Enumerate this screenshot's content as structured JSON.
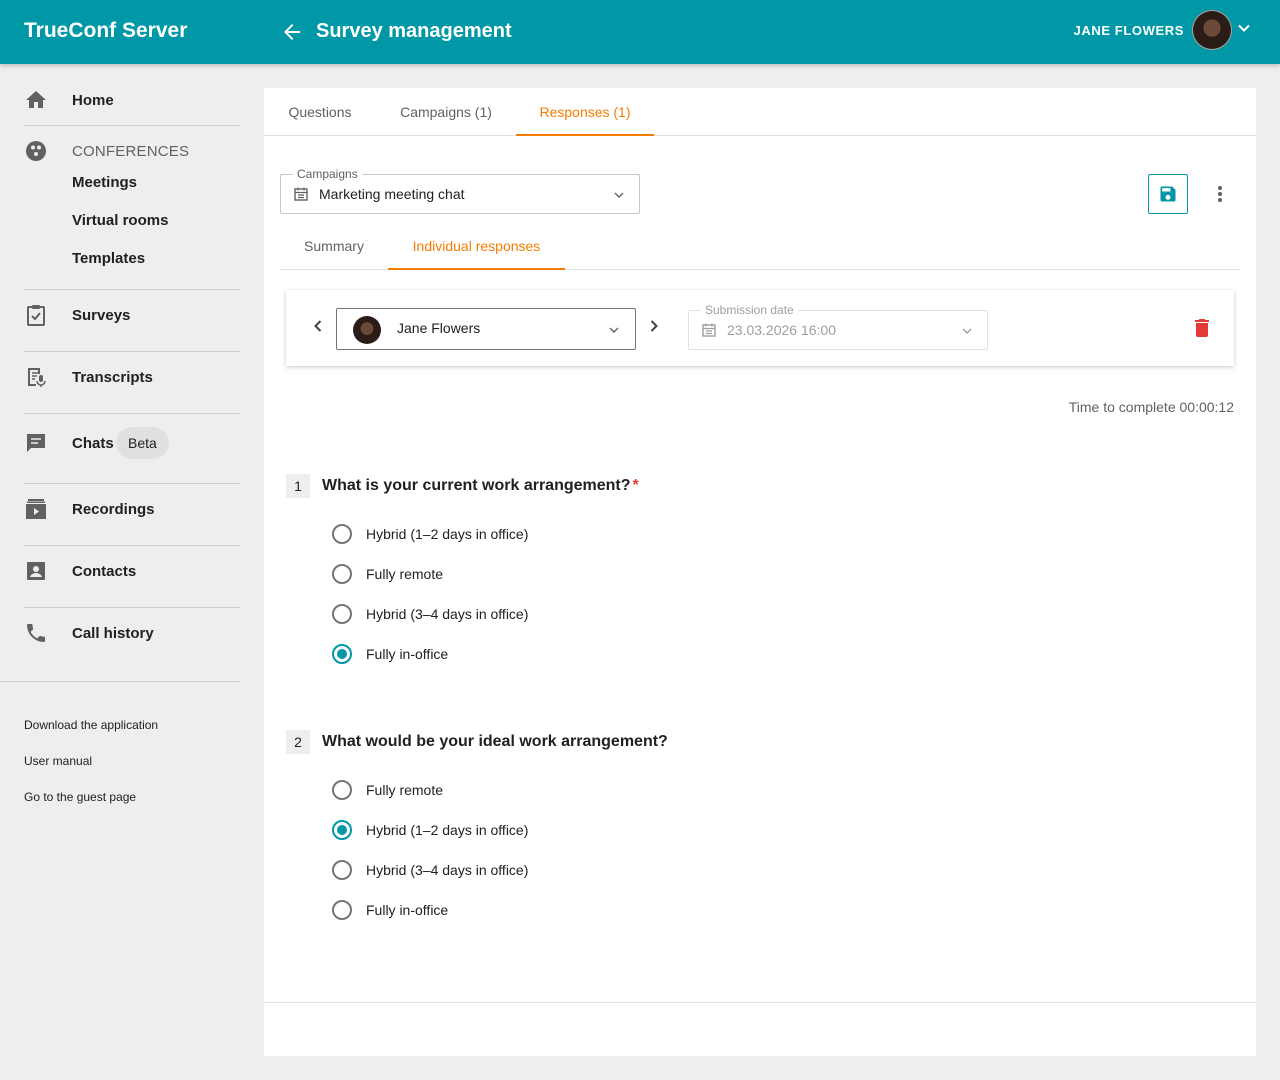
{
  "header": {
    "brand": "TrueConf Server",
    "title": "Survey management",
    "user_name": "JANE FLOWERS"
  },
  "sidebar": {
    "home": "Home",
    "conferences": "CONFERENCES",
    "meetings": "Meetings",
    "virtual_rooms": "Virtual rooms",
    "templates": "Templates",
    "surveys": "Surveys",
    "transcripts": "Transcripts",
    "chats": "Chats",
    "beta": "Beta",
    "recordings": "Recordings",
    "contacts": "Contacts",
    "call_history": "Call history",
    "footer": {
      "download": "Download the application",
      "manual": "User manual",
      "guest": "Go to the guest page"
    }
  },
  "tabs": {
    "questions": "Questions",
    "campaigns": "Campaigns (1)",
    "responses": "Responses (1)"
  },
  "campaign_select": {
    "label": "Campaigns",
    "value": "Marketing meeting chat"
  },
  "subtabs": {
    "summary": "Summary",
    "individual": "Individual responses"
  },
  "respondent": {
    "name": "Jane Flowers",
    "submission_label": "Submission date",
    "submission_value": "23.03.2026 16:00"
  },
  "time_to_complete": "Time to complete 00:00:12",
  "questions": [
    {
      "number": "1",
      "text": "What is your current work arrangement?",
      "required_mark": "*",
      "options": [
        "Hybrid (1–2 days in office)",
        "Fully remote",
        "Hybrid (3–4 days in office)",
        "Fully in-office"
      ],
      "selected": 3
    },
    {
      "number": "2",
      "text": "What would be your ideal work arrangement?",
      "options": [
        "Fully remote",
        "Hybrid (1–2 days in office)",
        "Hybrid (3–4 days in office)",
        "Fully in-office"
      ],
      "selected": 1
    }
  ],
  "colors": {
    "header": "#0097a7",
    "accent": "#f57c00",
    "radio_checked": "#0097a7",
    "delete": "#e53935"
  }
}
